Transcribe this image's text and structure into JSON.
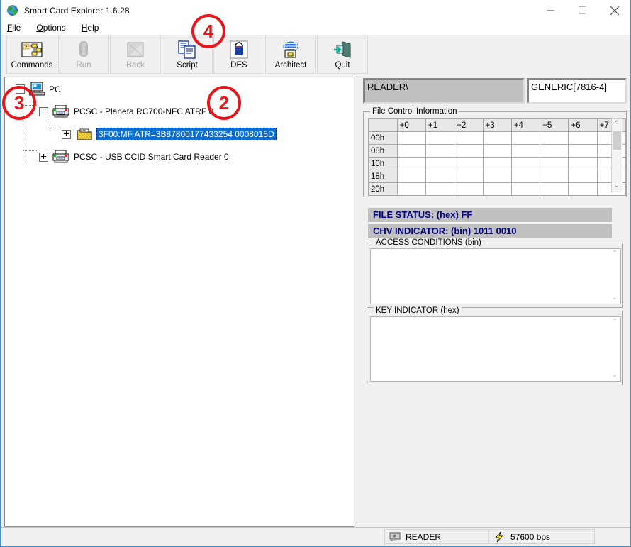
{
  "window": {
    "title": "Smart Card Explorer 1.6.28",
    "icon": "globe-icon",
    "minimize": "minimize-icon",
    "maximize": "maximize-icon",
    "close": "close-icon"
  },
  "menu": {
    "items": [
      {
        "label": "File",
        "accel": "F"
      },
      {
        "label": "Options",
        "accel": "O"
      },
      {
        "label": "Help",
        "accel": "H"
      }
    ]
  },
  "toolbar": {
    "buttons": [
      {
        "label": "Commands",
        "icon": "commands-icon",
        "enabled": true
      },
      {
        "label": "Run",
        "icon": "traffic-light-icon",
        "enabled": false
      },
      {
        "label": "Back",
        "icon": "back-icon",
        "enabled": false
      },
      {
        "label": "Script",
        "icon": "script-icon",
        "enabled": true
      },
      {
        "label": "DES",
        "icon": "des-icon",
        "enabled": true
      },
      {
        "label": "Architect",
        "icon": "architect-icon",
        "enabled": true
      },
      {
        "label": "Quit",
        "icon": "exit-door-icon",
        "enabled": true
      }
    ]
  },
  "tree": {
    "nodes": [
      {
        "label": "PC",
        "icon": "computer-icon",
        "expander": "minus",
        "selected": false
      },
      {
        "label": "PCSC - Planeta RC700-NFC ATRF 0",
        "icon": "card-reader-icon",
        "expander": "minus",
        "selected": false
      },
      {
        "label": "3F00:MF ATR=3B87800177433254 0008015D",
        "icon": "folder-icon",
        "expander": "plus",
        "selected": true
      },
      {
        "label": "PCSC - USB CCID Smart Card Reader 0",
        "icon": "card-reader-icon",
        "expander": "plus",
        "selected": false
      }
    ]
  },
  "details": {
    "reader_path": "READER\\",
    "card_type": "GENERIC[7816-4]",
    "fci": {
      "title": "File Control Information",
      "columns": [
        "",
        "+0",
        "+1",
        "+2",
        "+3",
        "+4",
        "+5",
        "+6",
        "+7"
      ],
      "rows": [
        {
          "header": "00h",
          "cells": [
            "",
            "",
            "",
            "",
            "",
            "",
            "",
            ""
          ]
        },
        {
          "header": "08h",
          "cells": [
            "",
            "",
            "",
            "",
            "",
            "",
            "",
            ""
          ]
        },
        {
          "header": "10h",
          "cells": [
            "",
            "",
            "",
            "",
            "",
            "",
            "",
            ""
          ]
        },
        {
          "header": "18h",
          "cells": [
            "",
            "",
            "",
            "",
            "",
            "",
            "",
            ""
          ]
        },
        {
          "header": "20h",
          "cells": [
            "",
            "",
            "",
            "",
            "",
            "",
            "",
            ""
          ]
        }
      ]
    },
    "file_status": "FILE STATUS: (hex) FF",
    "chv_indicator": "CHV INDICATOR: (bin) 1011 0010",
    "access_conditions": {
      "title": "ACCESS CONDITIONS (bin)",
      "value": ""
    },
    "key_indicator": {
      "title": "KEY INDICATOR (hex)",
      "value": ""
    }
  },
  "statusbar": {
    "reader": {
      "label": "READER",
      "icon": "reader-icon"
    },
    "speed": {
      "label": "57600 bps",
      "icon": "lightning-icon"
    }
  },
  "annotations": [
    {
      "label": "4"
    },
    {
      "label": "2"
    },
    {
      "label": "3"
    }
  ],
  "colors": {
    "selection": "#0a6fd1",
    "status_text": "#000080",
    "annotation": "#e8161b",
    "window_border": "#4a8fc4"
  }
}
